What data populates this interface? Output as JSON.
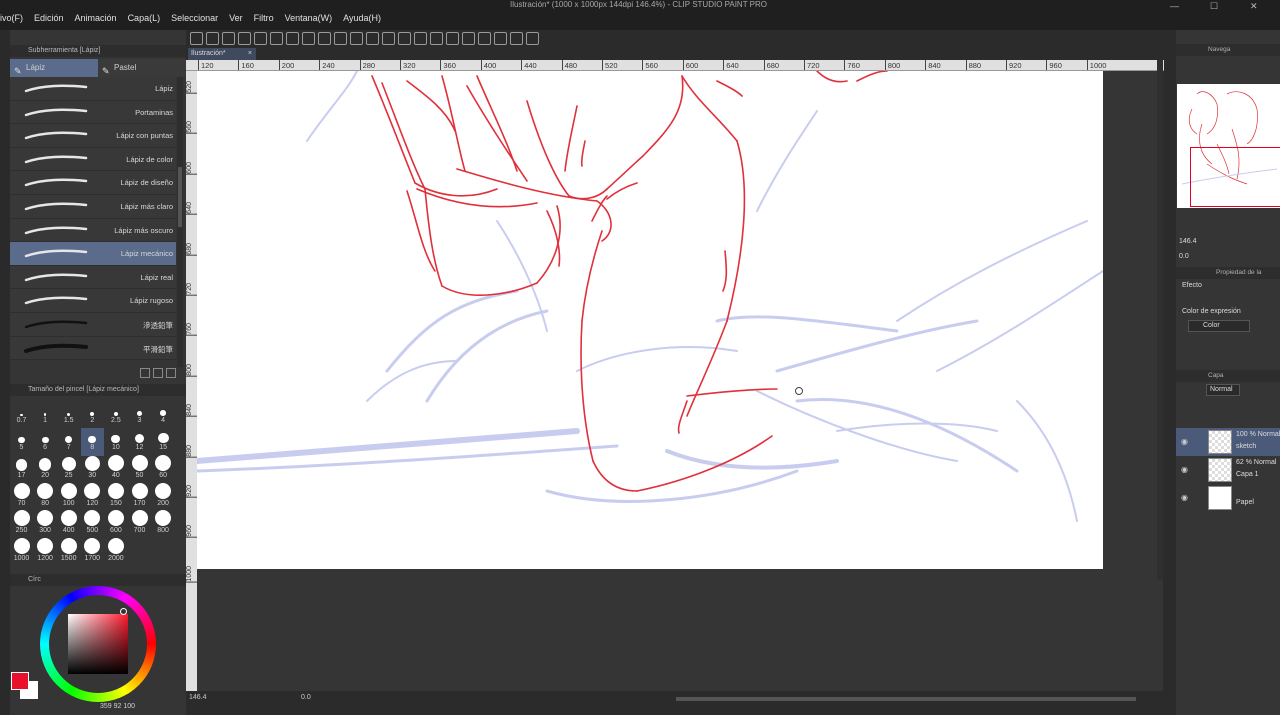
{
  "window": {
    "title": "Ilustración* (1000 x 1000px 144dpi 146.4%) - CLIP STUDIO PAINT PRO"
  },
  "menu": [
    "ivo(F)",
    "Edición",
    "Animación",
    "Capa(L)",
    "Seleccionar",
    "Ver",
    "Filtro",
    "Ventana(W)",
    "Ayuda(H)"
  ],
  "left_panel": {
    "subtool_header": "Subherramienta [Lápiz]",
    "tabs": [
      "Lápiz",
      "Pastel"
    ],
    "brushes": [
      "Lápiz",
      "Portaminas",
      "Lápiz con puntas",
      "Lápiz de color",
      "Lápiz de diseño",
      "Lápiz más claro",
      "Lápiz más oscuro",
      "Lápiz mecánico",
      "Lápiz real",
      "Lápiz rugoso",
      "滲透鉛筆",
      "平滑鉛筆"
    ],
    "active_brush_index": 7,
    "brush_size_header": "Tamaño del pincel [Lápiz mecánico]",
    "sizes": [
      "0.7",
      "1",
      "1.5",
      "2",
      "2.5",
      "3",
      "4",
      "5",
      "6",
      "7",
      "8",
      "10",
      "12",
      "15",
      "17",
      "20",
      "25",
      "30",
      "40",
      "50",
      "60",
      "70",
      "80",
      "100",
      "120",
      "150",
      "170",
      "200",
      "250",
      "300",
      "400",
      "500",
      "600",
      "700",
      "800",
      "1000",
      "1200",
      "1500",
      "1700",
      "2000"
    ],
    "active_size": "8",
    "color_header": "Círc",
    "color_values": "359  92  100",
    "main_color": "#e8102a",
    "sub_color": "#ffffff"
  },
  "canvas": {
    "tab_label": "Ilustración*",
    "ruler_top": [
      "120",
      "160",
      "200",
      "240",
      "280",
      "320",
      "360",
      "400",
      "440",
      "480",
      "520",
      "560",
      "600",
      "640",
      "680",
      "720",
      "760",
      "800",
      "840",
      "880",
      "920",
      "960",
      "1000"
    ],
    "ruler_left": [
      "520",
      "560",
      "600",
      "640",
      "680",
      "720",
      "760",
      "800",
      "840",
      "880",
      "920",
      "960",
      "1000"
    ],
    "zoom": "146.4",
    "rotation": "0.0",
    "sketch_color": "#e0303a",
    "rough_color": "#c8cdf0"
  },
  "right_panel": {
    "navigator_header": "Navega",
    "zoom_value": "146.4",
    "rotation_value": "0.0",
    "property_header": "Propiedad de la",
    "effect_label": "Efecto",
    "expression_label": "Color de expresión",
    "expression_value": "Color",
    "layer_header": "Capa",
    "blend_mode": "Normal",
    "layers": [
      {
        "line1": "100 % Normal",
        "line2": "sketch",
        "active": true
      },
      {
        "line1": "62 % Normal",
        "line2": "Capa 1",
        "active": false
      },
      {
        "line1": "",
        "line2": "Papel",
        "active": false
      }
    ]
  }
}
